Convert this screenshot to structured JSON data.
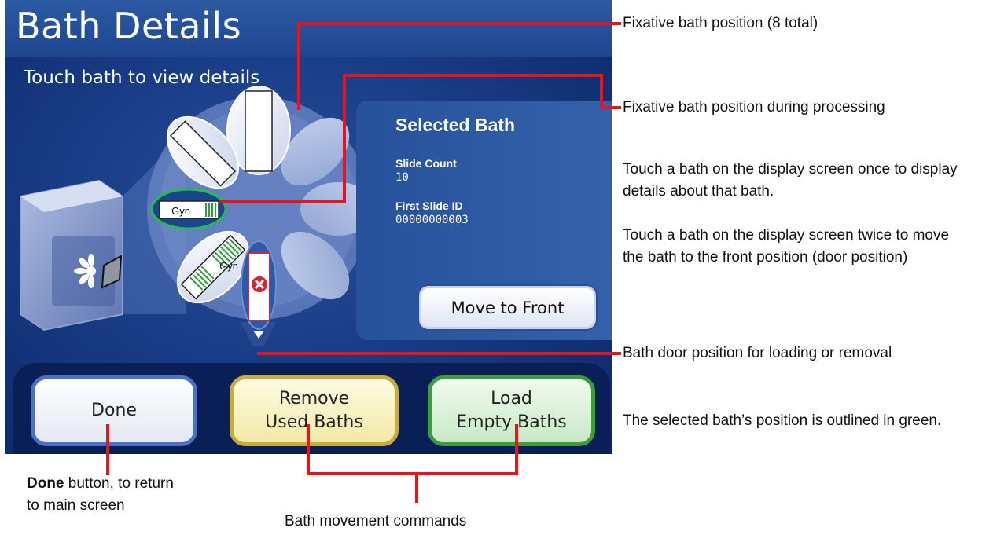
{
  "screen": {
    "title": "Bath Details",
    "subtitle": "Touch bath to view details",
    "bath_labels": {
      "gyn_selected": "Gyn",
      "gyn_lower": "Gyn"
    },
    "selected_panel": {
      "title": "Selected Bath",
      "slide_count_label": "Slide Count",
      "slide_count_value": "10",
      "first_slide_label": "First Slide ID",
      "first_slide_value": "00000000003",
      "move_button": "Move to Front"
    },
    "commands": {
      "done": "Done",
      "remove_line1": "Remove",
      "remove_line2": "Used Baths",
      "load_line1": "Load",
      "load_line2": "Empty Baths"
    }
  },
  "callouts": {
    "fixative_position": "Fixative bath position (8 total)",
    "processing_position": "Fixative bath position during processing",
    "touch_once": "Touch a bath on the display screen once to display details about that bath.",
    "touch_twice": "Touch a bath on the display screen twice to move the bath to the front position (door position)",
    "door_position": "Bath door position for loading or removal",
    "outlined_green": "The selected bath’s position is outlined in green.",
    "done_bold": "Done",
    "done_rest": " button, to return to main screen",
    "movement": "Bath movement commands"
  },
  "colors": {
    "screen_blue": "#183c86",
    "callout_red": "#e8141c",
    "selected_outline": "#22c04a",
    "done_border": "#4b70c4",
    "remove_border": "#c9ac40",
    "load_border": "#3e9c3e"
  },
  "icons": {
    "error_badge": "x-circle-icon",
    "door_indicator": "triangle-down-icon",
    "processor": "processor-device-icon"
  }
}
